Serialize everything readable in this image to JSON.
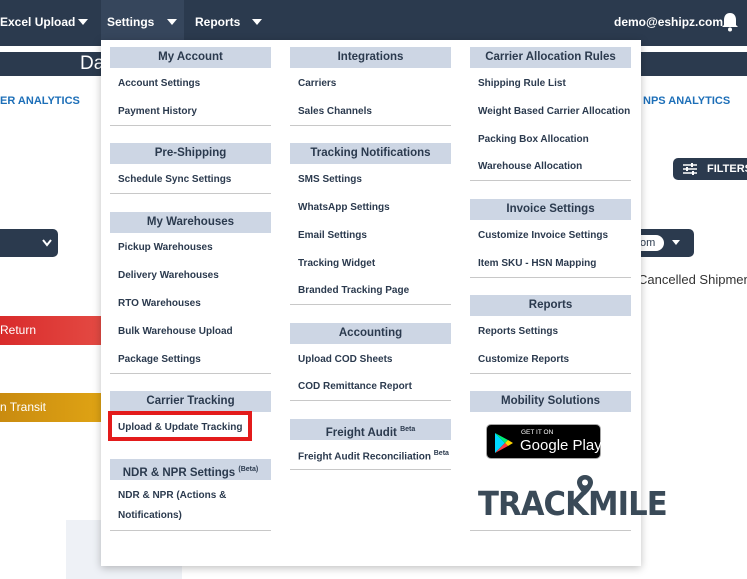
{
  "topnav": {
    "excel_upload": "Excel Upload",
    "settings": "Settings",
    "reports": "Reports",
    "user_email": "demo@eshipz.com"
  },
  "background": {
    "dashboard_title": "Da",
    "analytics_left": "ER ANALYTICS",
    "analytics_right": "NPS ANALYTICS",
    "filters": "FILTERS",
    "select_value": "om",
    "cancelled": "Cancelled Shipment",
    "return_label": "Return",
    "transit_label": "n Transit"
  },
  "menu": {
    "col1": {
      "my_account": {
        "title": "My Account",
        "items": [
          "Account Settings",
          "Payment History"
        ]
      },
      "pre_shipping": {
        "title": "Pre-Shipping",
        "items": [
          "Schedule Sync Settings"
        ]
      },
      "my_warehouses": {
        "title": "My Warehouses",
        "items": [
          "Pickup Warehouses",
          "Delivery Warehouses",
          "RTO Warehouses",
          "Bulk Warehouse Upload",
          "Package Settings"
        ]
      },
      "carrier_tracking": {
        "title": "Carrier Tracking",
        "items": [
          "Upload & Update Tracking"
        ]
      },
      "ndr": {
        "title": "NDR & NPR Settings",
        "badge": "(Beta)",
        "items": [
          "NDR & NPR (Actions &",
          "Notifications)"
        ]
      }
    },
    "col2": {
      "integrations": {
        "title": "Integrations",
        "items": [
          "Carriers",
          "Sales Channels"
        ]
      },
      "tracking_notifications": {
        "title": "Tracking Notifications",
        "items": [
          "SMS Settings",
          "WhatsApp Settings",
          "Email Settings",
          "Tracking Widget",
          "Branded Tracking Page"
        ]
      },
      "accounting": {
        "title": "Accounting",
        "items": [
          "Upload COD Sheets",
          "COD Remittance Report"
        ]
      },
      "freight_audit": {
        "title": "Freight Audit",
        "badge": "Beta",
        "items": [
          "Freight Audit Reconciliation"
        ],
        "item_badge": "Beta"
      }
    },
    "col3": {
      "carrier_allocation": {
        "title": "Carrier Allocation Rules",
        "items": [
          "Shipping Rule List",
          "Weight Based Carrier Allocation",
          "Packing Box Allocation",
          "Warehouse Allocation"
        ]
      },
      "invoice_settings": {
        "title": "Invoice Settings",
        "items": [
          "Customize Invoice Settings",
          "Item SKU - HSN Mapping"
        ]
      },
      "reports": {
        "title": "Reports",
        "items": [
          "Reports Settings",
          "Customize Reports"
        ]
      },
      "mobility": {
        "title": "Mobility Solutions",
        "gplay_small": "GET IT ON",
        "gplay_big": "Google Play",
        "trackmile": "TRACKMILE"
      }
    }
  },
  "colors": {
    "navbar": "#2b3a4e",
    "section_header": "#cdd6e4",
    "highlight": "#e31b1b"
  },
  "icons": {
    "bell": "bell-icon",
    "filters": "sliders-icon",
    "play": "google-play-icon"
  }
}
